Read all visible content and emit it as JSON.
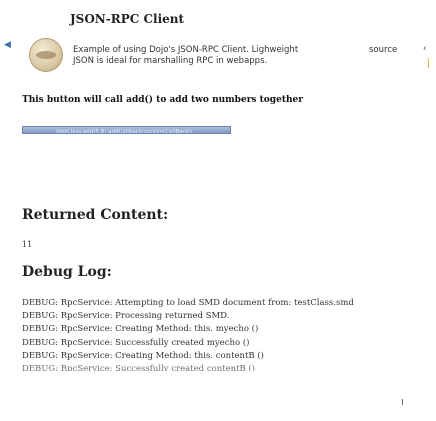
{
  "page": {
    "title": "JSON-RPC Client"
  },
  "header": {
    "description": "Example of using Dojo's JSON-RPC Client. Lighweight JSON is ideal for marshalling RPC in webapps.",
    "source_label": "source",
    "left_arrow_glyph": "◀",
    "right_arrow_glyph": "‹"
  },
  "main": {
    "instruction": "This button will call add() to add two numbers together",
    "button_label": "testClass.add(5,8).addCallback(contentCallBack);",
    "returned_heading": "Returned Content:",
    "returned_value": "11",
    "debug_heading": "Debug Log:",
    "debug_lines": [
      "DEBUG: RpcService: Attempting to load SMD document from: testClass.smd",
      "DEBUG: RpcService: Processing returned SMD.",
      "DEBUG: RpcService: Creating Method: this. myecho ()",
      "DEBUG: RpcService: Successfully created myecho ()",
      "DEBUG: RpcService: Creating Method: this. contentB ()",
      "DEBUG: RpcService: Successfully created contentB ()"
    ]
  },
  "colors": {
    "button_fill": "#7f9bc4",
    "accent_bar": "#d3b84a"
  }
}
